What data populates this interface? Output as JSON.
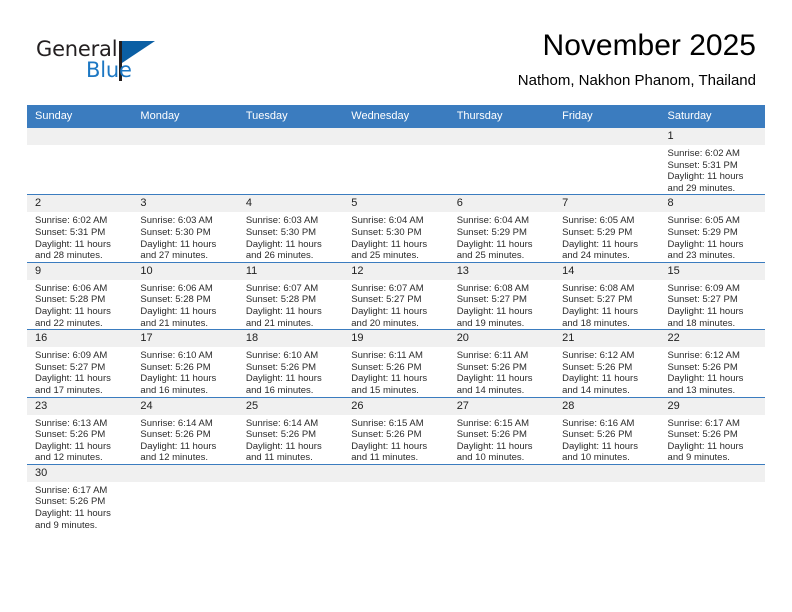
{
  "brand": {
    "name_top": "General",
    "name_bottom": "Blue",
    "logo_icon": "triangle-flag-icon",
    "accent_color": "#1c77c3",
    "dark_color": "#231f20"
  },
  "header": {
    "month_title": "November 2025",
    "location": "Nathom, Nakhon Phanom, Thailand"
  },
  "calendar": {
    "header_bg_color": "#3b7cbf",
    "daynum_bg_color": "#f0f0f0",
    "weekday_headers": [
      "Sunday",
      "Monday",
      "Tuesday",
      "Wednesday",
      "Thursday",
      "Friday",
      "Saturday"
    ],
    "weeks": [
      [
        {
          "day": "",
          "lines": []
        },
        {
          "day": "",
          "lines": []
        },
        {
          "day": "",
          "lines": []
        },
        {
          "day": "",
          "lines": []
        },
        {
          "day": "",
          "lines": []
        },
        {
          "day": "",
          "lines": []
        },
        {
          "day": "1",
          "lines": [
            "Sunrise: 6:02 AM",
            "Sunset: 5:31 PM",
            "Daylight: 11 hours",
            "and 29 minutes."
          ]
        }
      ],
      [
        {
          "day": "2",
          "lines": [
            "Sunrise: 6:02 AM",
            "Sunset: 5:31 PM",
            "Daylight: 11 hours",
            "and 28 minutes."
          ]
        },
        {
          "day": "3",
          "lines": [
            "Sunrise: 6:03 AM",
            "Sunset: 5:30 PM",
            "Daylight: 11 hours",
            "and 27 minutes."
          ]
        },
        {
          "day": "4",
          "lines": [
            "Sunrise: 6:03 AM",
            "Sunset: 5:30 PM",
            "Daylight: 11 hours",
            "and 26 minutes."
          ]
        },
        {
          "day": "5",
          "lines": [
            "Sunrise: 6:04 AM",
            "Sunset: 5:30 PM",
            "Daylight: 11 hours",
            "and 25 minutes."
          ]
        },
        {
          "day": "6",
          "lines": [
            "Sunrise: 6:04 AM",
            "Sunset: 5:29 PM",
            "Daylight: 11 hours",
            "and 25 minutes."
          ]
        },
        {
          "day": "7",
          "lines": [
            "Sunrise: 6:05 AM",
            "Sunset: 5:29 PM",
            "Daylight: 11 hours",
            "and 24 minutes."
          ]
        },
        {
          "day": "8",
          "lines": [
            "Sunrise: 6:05 AM",
            "Sunset: 5:29 PM",
            "Daylight: 11 hours",
            "and 23 minutes."
          ]
        }
      ],
      [
        {
          "day": "9",
          "lines": [
            "Sunrise: 6:06 AM",
            "Sunset: 5:28 PM",
            "Daylight: 11 hours",
            "and 22 minutes."
          ]
        },
        {
          "day": "10",
          "lines": [
            "Sunrise: 6:06 AM",
            "Sunset: 5:28 PM",
            "Daylight: 11 hours",
            "and 21 minutes."
          ]
        },
        {
          "day": "11",
          "lines": [
            "Sunrise: 6:07 AM",
            "Sunset: 5:28 PM",
            "Daylight: 11 hours",
            "and 21 minutes."
          ]
        },
        {
          "day": "12",
          "lines": [
            "Sunrise: 6:07 AM",
            "Sunset: 5:27 PM",
            "Daylight: 11 hours",
            "and 20 minutes."
          ]
        },
        {
          "day": "13",
          "lines": [
            "Sunrise: 6:08 AM",
            "Sunset: 5:27 PM",
            "Daylight: 11 hours",
            "and 19 minutes."
          ]
        },
        {
          "day": "14",
          "lines": [
            "Sunrise: 6:08 AM",
            "Sunset: 5:27 PM",
            "Daylight: 11 hours",
            "and 18 minutes."
          ]
        },
        {
          "day": "15",
          "lines": [
            "Sunrise: 6:09 AM",
            "Sunset: 5:27 PM",
            "Daylight: 11 hours",
            "and 18 minutes."
          ]
        }
      ],
      [
        {
          "day": "16",
          "lines": [
            "Sunrise: 6:09 AM",
            "Sunset: 5:27 PM",
            "Daylight: 11 hours",
            "and 17 minutes."
          ]
        },
        {
          "day": "17",
          "lines": [
            "Sunrise: 6:10 AM",
            "Sunset: 5:26 PM",
            "Daylight: 11 hours",
            "and 16 minutes."
          ]
        },
        {
          "day": "18",
          "lines": [
            "Sunrise: 6:10 AM",
            "Sunset: 5:26 PM",
            "Daylight: 11 hours",
            "and 16 minutes."
          ]
        },
        {
          "day": "19",
          "lines": [
            "Sunrise: 6:11 AM",
            "Sunset: 5:26 PM",
            "Daylight: 11 hours",
            "and 15 minutes."
          ]
        },
        {
          "day": "20",
          "lines": [
            "Sunrise: 6:11 AM",
            "Sunset: 5:26 PM",
            "Daylight: 11 hours",
            "and 14 minutes."
          ]
        },
        {
          "day": "21",
          "lines": [
            "Sunrise: 6:12 AM",
            "Sunset: 5:26 PM",
            "Daylight: 11 hours",
            "and 14 minutes."
          ]
        },
        {
          "day": "22",
          "lines": [
            "Sunrise: 6:12 AM",
            "Sunset: 5:26 PM",
            "Daylight: 11 hours",
            "and 13 minutes."
          ]
        }
      ],
      [
        {
          "day": "23",
          "lines": [
            "Sunrise: 6:13 AM",
            "Sunset: 5:26 PM",
            "Daylight: 11 hours",
            "and 12 minutes."
          ]
        },
        {
          "day": "24",
          "lines": [
            "Sunrise: 6:14 AM",
            "Sunset: 5:26 PM",
            "Daylight: 11 hours",
            "and 12 minutes."
          ]
        },
        {
          "day": "25",
          "lines": [
            "Sunrise: 6:14 AM",
            "Sunset: 5:26 PM",
            "Daylight: 11 hours",
            "and 11 minutes."
          ]
        },
        {
          "day": "26",
          "lines": [
            "Sunrise: 6:15 AM",
            "Sunset: 5:26 PM",
            "Daylight: 11 hours",
            "and 11 minutes."
          ]
        },
        {
          "day": "27",
          "lines": [
            "Sunrise: 6:15 AM",
            "Sunset: 5:26 PM",
            "Daylight: 11 hours",
            "and 10 minutes."
          ]
        },
        {
          "day": "28",
          "lines": [
            "Sunrise: 6:16 AM",
            "Sunset: 5:26 PM",
            "Daylight: 11 hours",
            "and 10 minutes."
          ]
        },
        {
          "day": "29",
          "lines": [
            "Sunrise: 6:17 AM",
            "Sunset: 5:26 PM",
            "Daylight: 11 hours",
            "and 9 minutes."
          ]
        }
      ],
      [
        {
          "day": "30",
          "lines": [
            "Sunrise: 6:17 AM",
            "Sunset: 5:26 PM",
            "Daylight: 11 hours",
            "and 9 minutes."
          ]
        },
        {
          "day": "",
          "lines": []
        },
        {
          "day": "",
          "lines": []
        },
        {
          "day": "",
          "lines": []
        },
        {
          "day": "",
          "lines": []
        },
        {
          "day": "",
          "lines": []
        },
        {
          "day": "",
          "lines": []
        }
      ]
    ]
  }
}
